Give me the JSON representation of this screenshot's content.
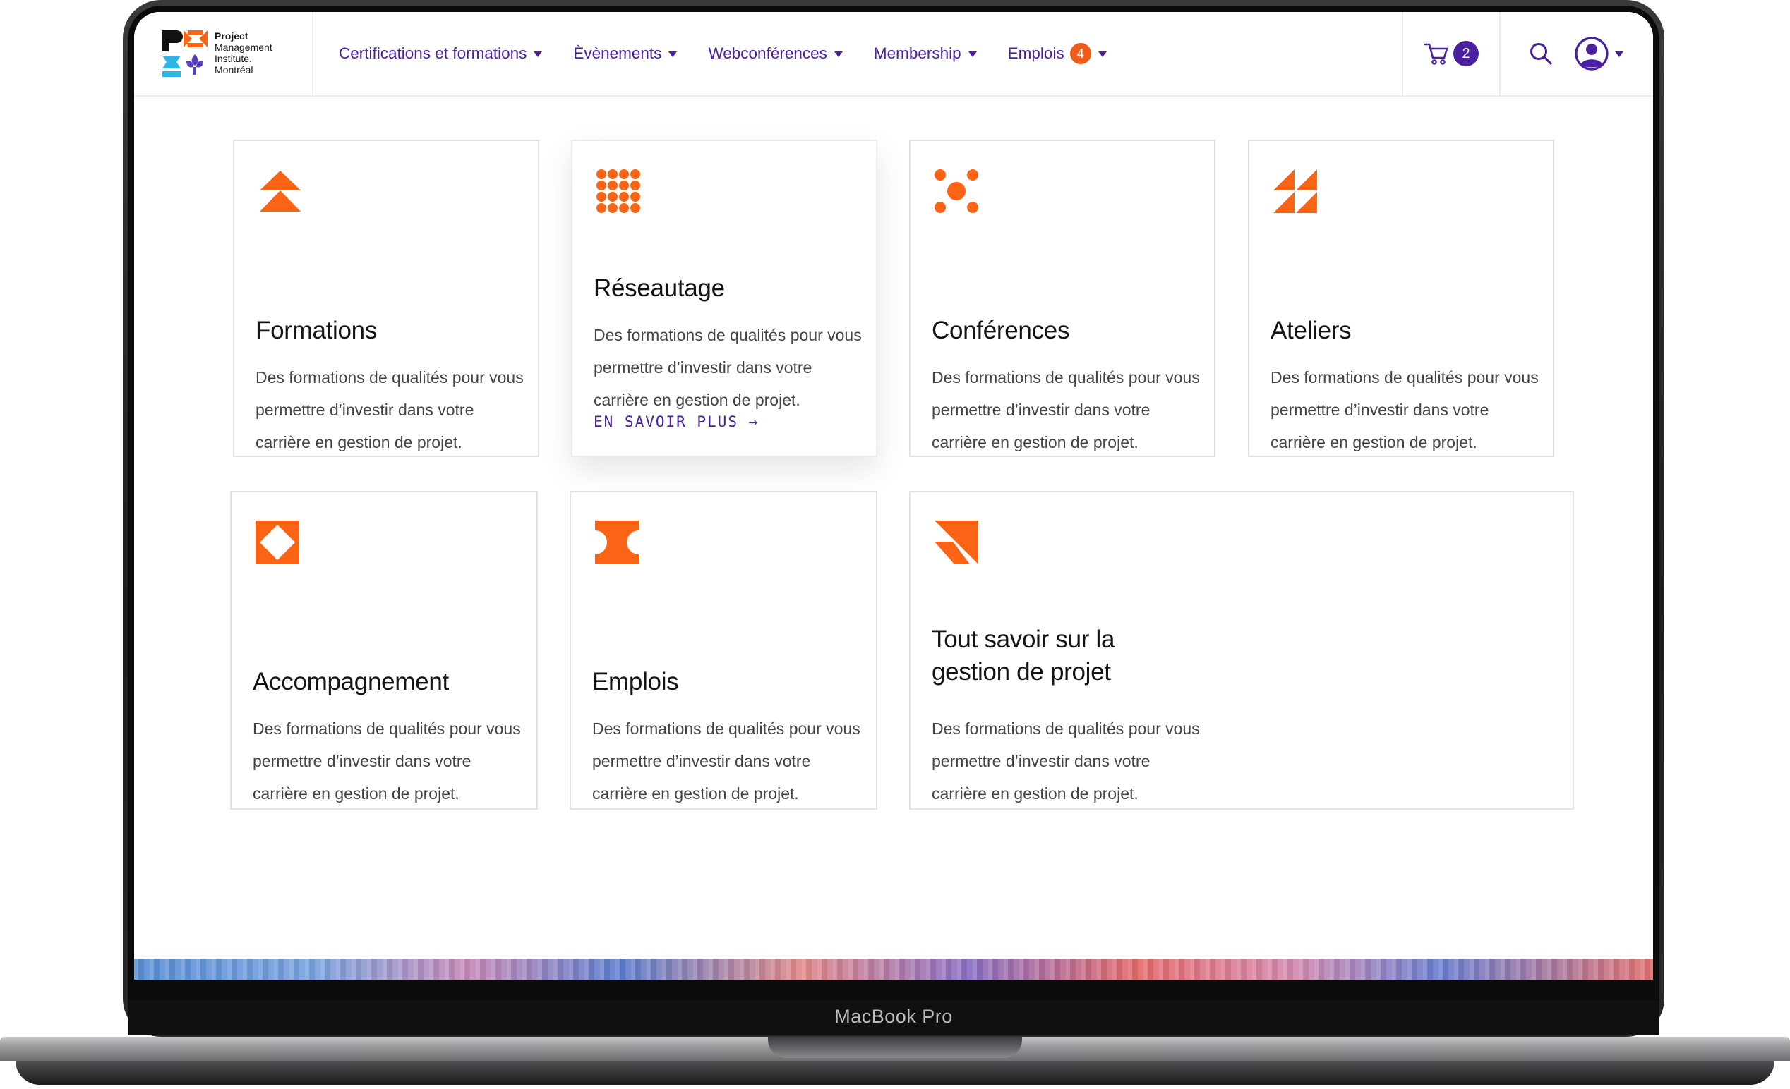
{
  "device": {
    "label": "MacBook Pro"
  },
  "logo": {
    "line1": "Project",
    "line2": "Management",
    "line3": "Institute.",
    "line4": "Montréal"
  },
  "nav": {
    "items": [
      {
        "label": "Certifications et formations"
      },
      {
        "label": "Èvènements"
      },
      {
        "label": "Webconférences"
      },
      {
        "label": "Membership"
      },
      {
        "label": "Emplois",
        "badge": "4"
      }
    ],
    "cart_count": "2"
  },
  "colors": {
    "accent": "#4a1fa0",
    "brand_orange": "#fa6414",
    "badge_orange": "#f05a1a"
  },
  "cards": [
    {
      "title": "Formations",
      "description": "Des formations de qualités pour vous permettre d’investir dans votre carrière en gestion de projet.",
      "icon": "chevrons-up-icon"
    },
    {
      "title": "Réseautage",
      "description": "Des formations de qualités pour vous permettre d’investir dans votre carrière en gestion de projet.",
      "icon": "dot-grid-icon",
      "link": "EN SAVOIR PLUS →"
    },
    {
      "title": "Conférences",
      "description": "Des formations de qualités pour vous permettre d’investir dans votre carrière en gestion de projet.",
      "icon": "dots-cluster-icon"
    },
    {
      "title": "Ateliers",
      "description": "Des formations de qualités pour vous permettre d’investir dans votre carrière en gestion de projet.",
      "icon": "triangles-icon"
    },
    {
      "title": "Accompagnement",
      "description": "Des formations de qualités pour vous permettre d’investir dans votre carrière en gestion de projet.",
      "icon": "diamond-square-icon"
    },
    {
      "title": "Emplois",
      "description": "Des formations de qualités pour vous permettre d’investir dans votre carrière en gestion de projet.",
      "icon": "notched-block-icon"
    },
    {
      "title_line1": "Tout savoir sur la",
      "title_line2": "gestion de projet",
      "description": "Des formations de qualités pour vous permettre d’investir dans votre carrière en gestion de projet.",
      "icon": "arrow-corner-icon"
    }
  ]
}
